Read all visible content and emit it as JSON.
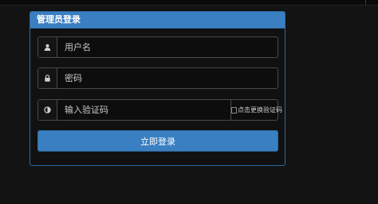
{
  "panel": {
    "title": "管理员登录"
  },
  "form": {
    "username_placeholder": "用户名",
    "password_placeholder": "密码",
    "captcha_placeholder": "输入验证码",
    "captcha_image_alt": "点击更换验证码",
    "submit_label": "立即登录"
  },
  "icons": {
    "username": "user-icon",
    "password": "lock-icon",
    "captcha": "contrast-icon"
  },
  "colors": {
    "accent": "#3a7fc1",
    "background": "#131313",
    "border": "#4a4a4a"
  }
}
